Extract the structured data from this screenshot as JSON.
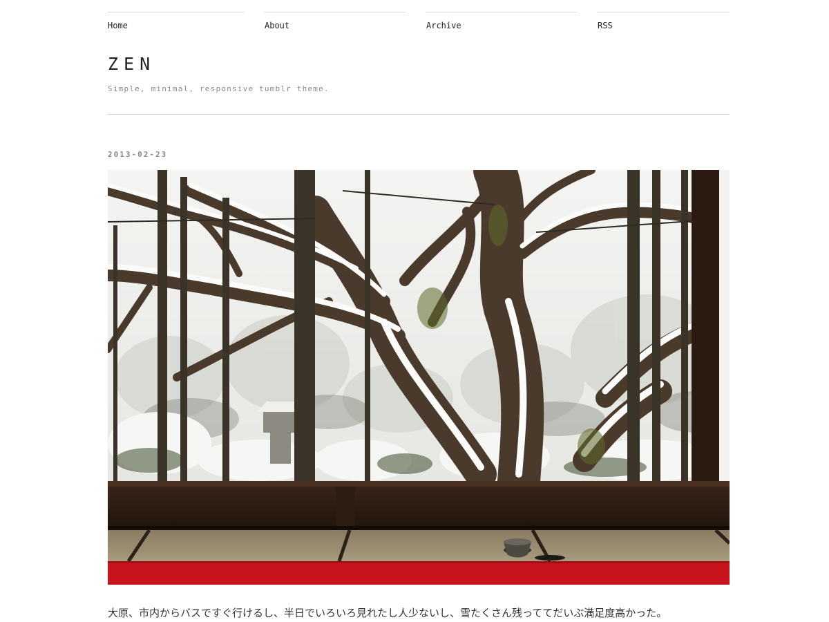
{
  "nav": {
    "items": [
      {
        "label": "Home"
      },
      {
        "label": "About"
      },
      {
        "label": "Archive"
      },
      {
        "label": "RSS"
      }
    ]
  },
  "header": {
    "title": "ZEN",
    "description": "Simple, minimal, responsive tumblr theme."
  },
  "post": {
    "date": "2013-02-23",
    "photo_icon": "photo-snow-garden",
    "text": "大原、市内からバスですぐ行けるし、半日でいろいろ見れたし人少ないし、雪たくさん残っててだいぶ満足度高かった。"
  },
  "colors": {
    "background": "#ffffff",
    "rule": "#d6d6d6",
    "muted_text": "#8a8a8a",
    "carpet_red": "#c8141c"
  }
}
